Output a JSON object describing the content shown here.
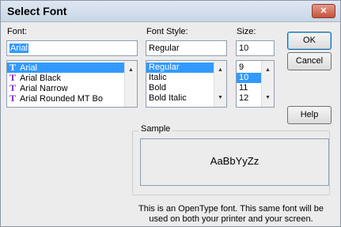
{
  "window": {
    "title": "Select Font",
    "close_label": "✕"
  },
  "font": {
    "label": "Font:",
    "value": "Arial",
    "items": [
      {
        "name": "Arial",
        "icon": "truetype-icon",
        "selected": true
      },
      {
        "name": "Arial Black",
        "icon": "truetype-icon"
      },
      {
        "name": "Arial Narrow",
        "icon": "truetype-icon"
      },
      {
        "name": "Arial Rounded MT Bo",
        "icon": "truetype-icon"
      }
    ]
  },
  "style": {
    "label": "Font Style:",
    "value": "Regular",
    "items": [
      "Regular",
      "Italic",
      "Bold",
      "Bold Italic"
    ],
    "selected": "Regular"
  },
  "size": {
    "label": "Size:",
    "value": "10",
    "items": [
      "9",
      "10",
      "11",
      "12"
    ],
    "selected": "10"
  },
  "buttons": {
    "ok": "OK",
    "cancel": "Cancel",
    "help": "Help"
  },
  "sample": {
    "label": "Sample",
    "text": "AaBbYyZz"
  },
  "description": "This is an OpenType font. This same font will be used on both your printer and your screen.",
  "colors": {
    "selection": "#3399ff",
    "truetype_icon": "#7c2ac2"
  }
}
